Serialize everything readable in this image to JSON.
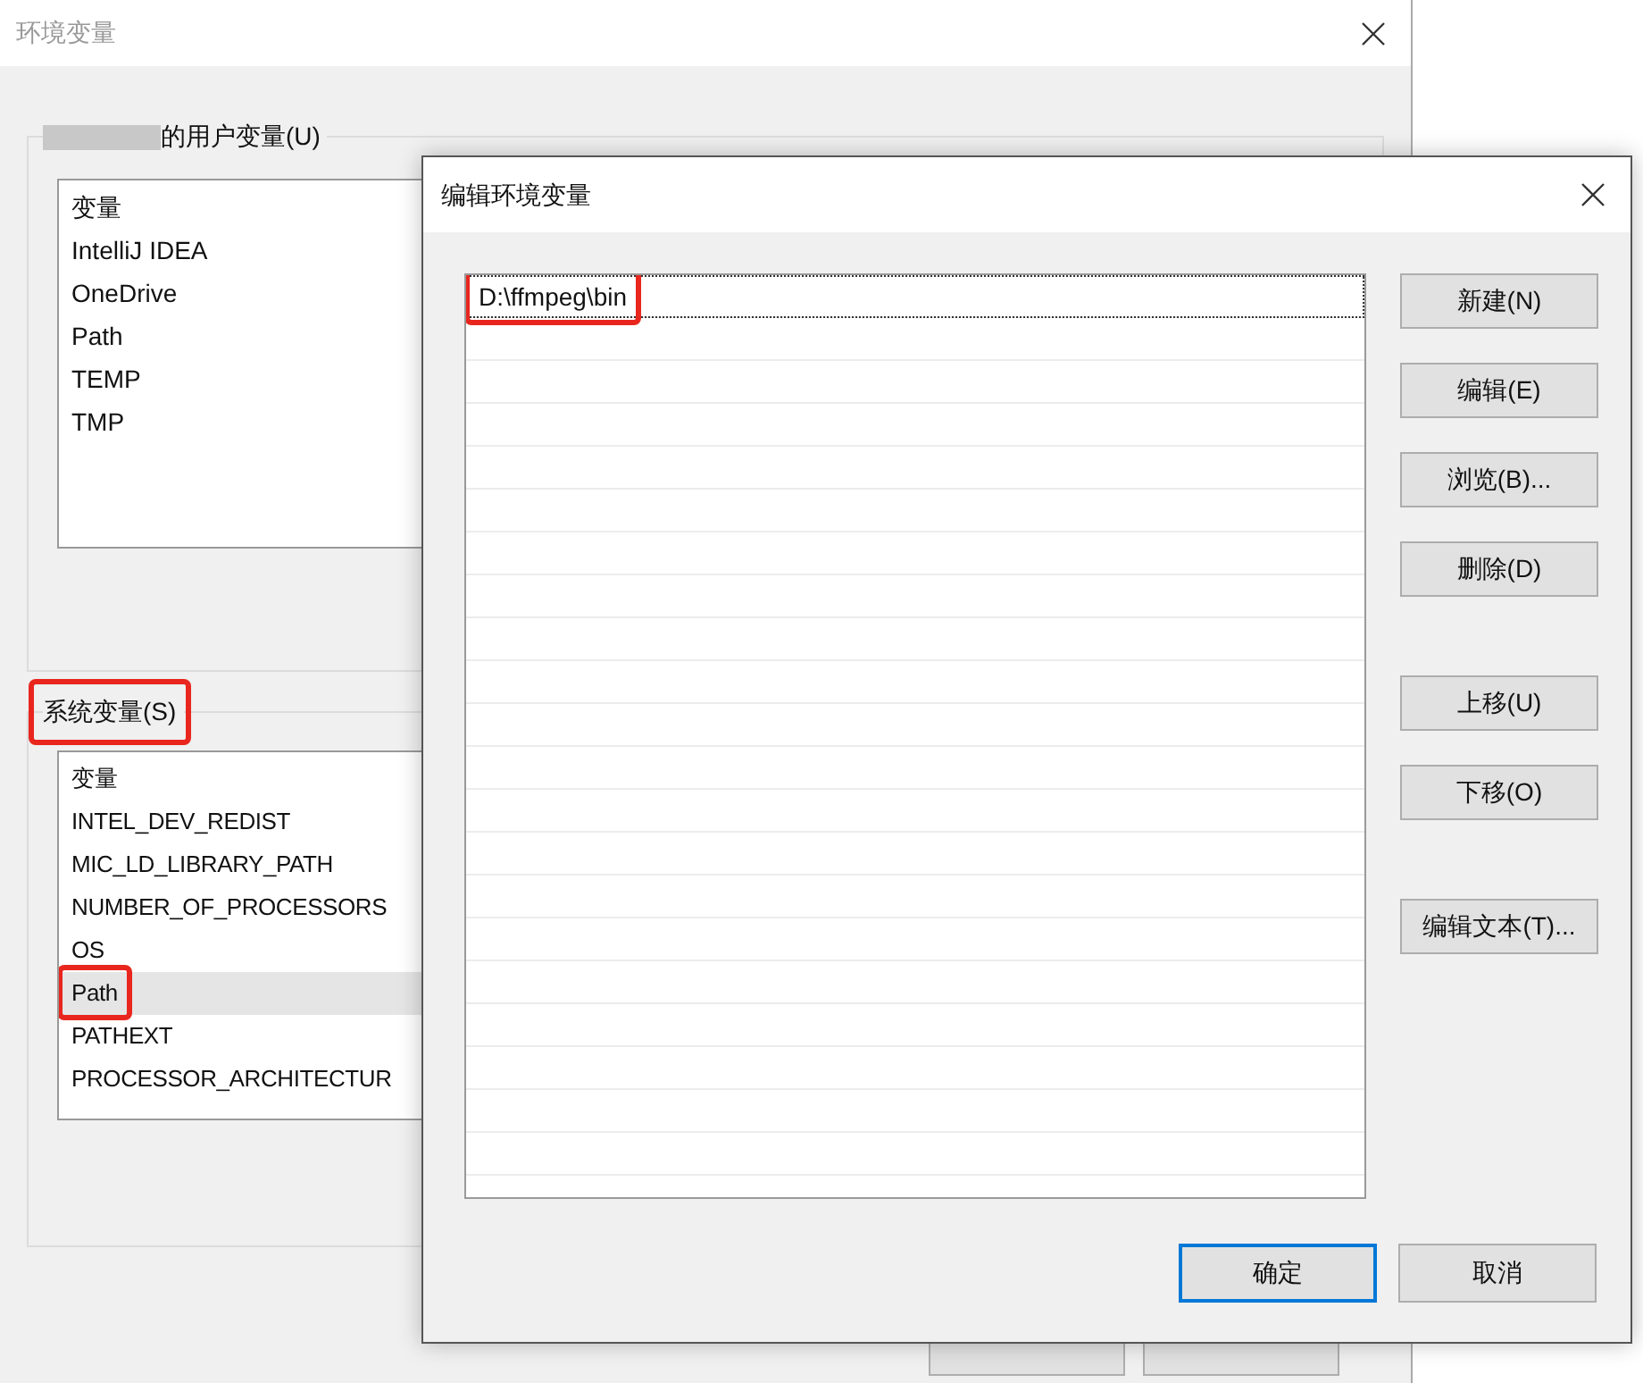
{
  "back_window": {
    "title": "环境变量",
    "user_group": {
      "label": "的用户变量(U)",
      "rows": [
        "变量",
        "IntelliJ IDEA",
        "OneDrive",
        "Path",
        "TEMP",
        "TMP"
      ]
    },
    "system_group": {
      "label": "系统变量(S)",
      "highlighted": true,
      "rows": [
        {
          "name": "变量",
          "selected": false,
          "highlighted": false
        },
        {
          "name": "INTEL_DEV_REDIST",
          "selected": false,
          "highlighted": false
        },
        {
          "name": "MIC_LD_LIBRARY_PATH",
          "selected": false,
          "highlighted": false
        },
        {
          "name": "NUMBER_OF_PROCESSORS",
          "selected": false,
          "highlighted": false
        },
        {
          "name": "OS",
          "selected": false,
          "highlighted": false
        },
        {
          "name": "Path",
          "selected": true,
          "highlighted": true
        },
        {
          "name": "PATHEXT",
          "selected": false,
          "highlighted": false
        },
        {
          "name": "PROCESSOR_ARCHITECTUR",
          "selected": false,
          "highlighted": false
        }
      ]
    }
  },
  "dialog": {
    "title": "编辑环境变量",
    "entries": [
      {
        "text": "D:\\ffmpeg\\bin",
        "focused": true,
        "highlighted": true
      }
    ],
    "side_button_groups": [
      [
        "新建(N)",
        "编辑(E)",
        "浏览(B)...",
        "删除(D)"
      ],
      [
        "上移(U)",
        "下移(O)"
      ],
      [
        "编辑文本(T)..."
      ]
    ],
    "ok_button": {
      "label": "确定",
      "default": true
    },
    "cancel_button": {
      "label": "取消"
    }
  }
}
